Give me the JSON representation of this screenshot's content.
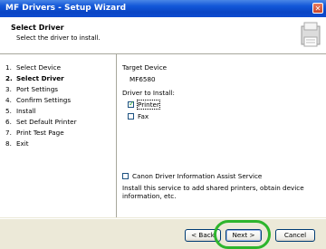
{
  "window": {
    "title": "MF Drivers - Setup Wizard",
    "close_glyph": "✕"
  },
  "header": {
    "title": "Select Driver",
    "subtitle": "Select the driver to install."
  },
  "steps": [
    {
      "num": "1.",
      "label": "Select Device"
    },
    {
      "num": "2.",
      "label": "Select Driver"
    },
    {
      "num": "3.",
      "label": "Port Settings"
    },
    {
      "num": "4.",
      "label": "Confirm Settings"
    },
    {
      "num": "5.",
      "label": "Install"
    },
    {
      "num": "6.",
      "label": "Set Default Printer"
    },
    {
      "num": "7.",
      "label": "Print Test Page"
    },
    {
      "num": "8.",
      "label": "Exit"
    }
  ],
  "active_step": 2,
  "content": {
    "target_label": "Target Device",
    "target_value": "MF6580",
    "driver_label": "Driver to Install:",
    "printer_option": {
      "label": "Printer",
      "checked": true
    },
    "fax_option": {
      "label": "Fax",
      "checked": false
    },
    "assist_option": {
      "label": "Canon Driver Information Assist Service",
      "checked": false
    },
    "assist_desc_line1": "Install this service to add shared printers, obtain device",
    "assist_desc_line2": "information, etc."
  },
  "buttons": {
    "back": "< Back",
    "next": "Next >",
    "cancel": "Cancel"
  },
  "colors": {
    "highlight": "#2db52d",
    "titlebar": "#0a45c4"
  }
}
